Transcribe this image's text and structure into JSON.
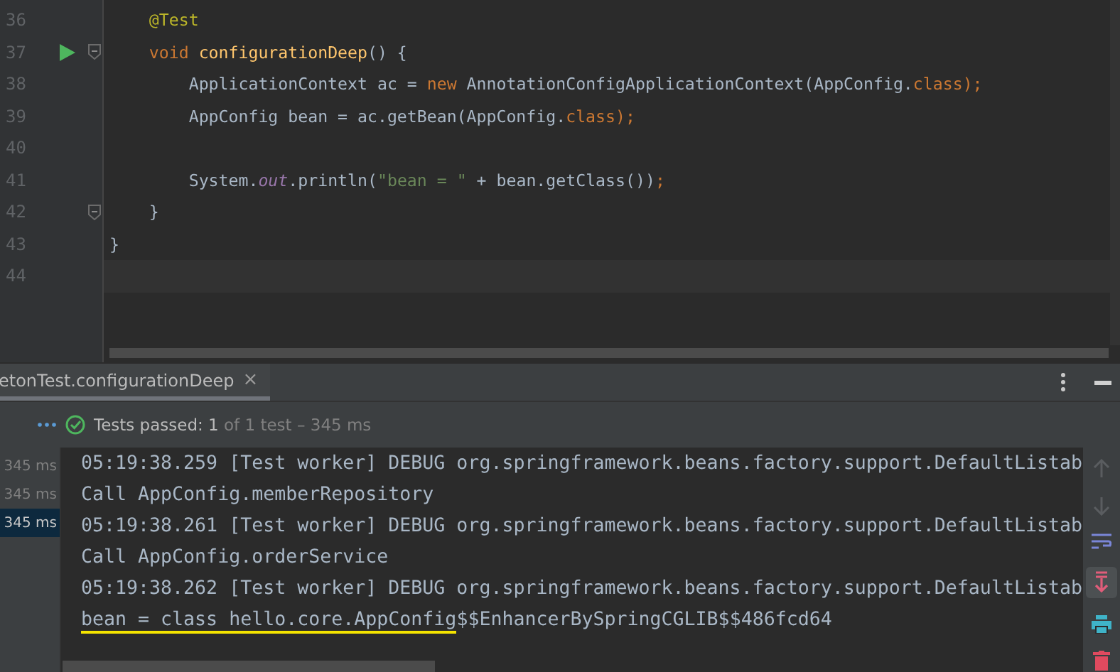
{
  "editor": {
    "lines": [
      {
        "number": "36",
        "tokens": [
          {
            "text": "    @Test",
            "kind": "annotation"
          }
        ]
      },
      {
        "number": "37",
        "run": true,
        "fold": true,
        "tokens": [
          {
            "text": "    void",
            "kind": "keyword"
          },
          {
            "text": " configurationDeep",
            "kind": "method"
          },
          {
            "text": "() {",
            "kind": "plain"
          }
        ]
      },
      {
        "number": "38",
        "tokens": [
          {
            "text": "        ApplicationContext ac = ",
            "kind": "plain"
          },
          {
            "text": "new",
            "kind": "keyword"
          },
          {
            "text": " AnnotationConfigApplicationContext(AppConfig.",
            "kind": "plain"
          },
          {
            "text": "class",
            "kind": "keyword"
          },
          {
            "text": ");",
            "kind": "keyword"
          }
        ]
      },
      {
        "number": "39",
        "tokens": [
          {
            "text": "        AppConfig bean = ac.getBean(AppConfig.",
            "kind": "plain"
          },
          {
            "text": "class",
            "kind": "keyword"
          },
          {
            "text": ");",
            "kind": "keyword"
          }
        ]
      },
      {
        "number": "40"
      },
      {
        "number": "41",
        "tokens": [
          {
            "text": "        System.",
            "kind": "plain"
          },
          {
            "text": "out",
            "kind": "static"
          },
          {
            "text": ".println(",
            "kind": "plain"
          },
          {
            "text": "\"bean = \"",
            "kind": "string"
          },
          {
            "text": " + bean.getClass())",
            "kind": "plain"
          },
          {
            "text": ";",
            "kind": "keyword"
          }
        ]
      },
      {
        "number": "42",
        "fold": true,
        "tokens": [
          {
            "text": "    }",
            "kind": "plain"
          }
        ]
      },
      {
        "number": "43",
        "tokens": [
          {
            "text": "}",
            "kind": "plain"
          }
        ]
      },
      {
        "number": "44",
        "current": true
      }
    ]
  },
  "run_panel": {
    "tab": {
      "label": "etonTest.configurationDeep",
      "close": "×",
      "selected": true
    },
    "status": {
      "label": "Tests passed:",
      "passed": "1",
      "rest": "of 1 test – 345 ms"
    },
    "tree_items": [
      {
        "time": "345 ms",
        "selected": false
      },
      {
        "time": "345 ms",
        "selected": false
      },
      {
        "time": "345 ms",
        "selected": true
      }
    ],
    "console_lines": [
      {
        "text": "05:19:38.259 [Test worker] DEBUG org.springframework.beans.factory.support.DefaultListab",
        "underlined": false
      },
      {
        "text": "Call AppConfig.memberRepository",
        "underlined": false
      },
      {
        "text": "05:19:38.261 [Test worker] DEBUG org.springframework.beans.factory.support.DefaultListab",
        "underlined": false
      },
      {
        "text": "Call AppConfig.orderService",
        "underlined": false
      },
      {
        "text": "05:19:38.262 [Test worker] DEBUG org.springframework.beans.factory.support.DefaultListab",
        "underlined": false
      },
      {
        "text": "bean = class hello.core.AppConfig",
        "tail": "$$EnhancerBySpringCGLIB$$486fcd64",
        "underlined": true
      }
    ]
  }
}
